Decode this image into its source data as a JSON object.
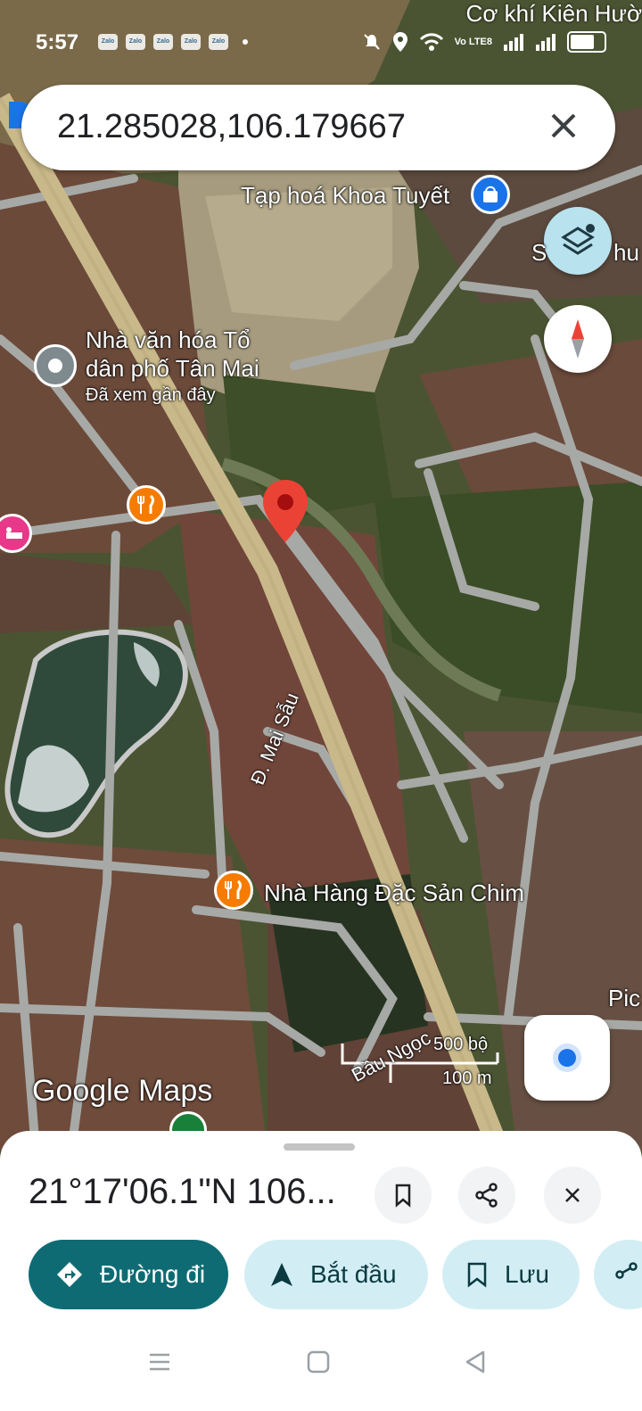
{
  "status_bar": {
    "time": "5:57",
    "notification_apps": [
      "Zalo",
      "Zalo",
      "Zalo",
      "Zalo",
      "Zalo"
    ],
    "network_label": "Vo LTE8"
  },
  "search": {
    "query": "21.285028,106.179667"
  },
  "map_labels": {
    "top_right": "Cơ khí Kiên Hườ",
    "shop": "Tạp hoá Khoa Tuyết",
    "cultural_house_line1": "Nhà văn hóa Tổ",
    "cultural_house_line2": "dân phố Tân Mai",
    "recently_viewed": "Đã xem gần đây",
    "street_mai_sau": "Đ. Mai Sẫu",
    "restaurant": "Nhà Hàng Đặc Sản Chim",
    "bau_ngoc": "Bầu Ngọc",
    "partial_right_1": "S",
    "partial_right_2": "hu",
    "partial_right_3": "Pic",
    "scale_feet": "500 bộ",
    "scale_meters": "100 m",
    "google_maps_logo": "Google Maps"
  },
  "bottom_sheet": {
    "coordinates": "21°17'06.1\"N 106...",
    "directions_label": "Đường đi",
    "start_label": "Bắt đầu",
    "save_label": "Lưu"
  },
  "colors": {
    "accent_teal": "#0f6b73",
    "pill_light": "#d2eef4",
    "pin_red": "#ea4335",
    "restaurant_orange": "#f57c00",
    "shop_blue": "#1a73e8",
    "hotel_pink": "#e8388a",
    "location_blue": "#1a73e8"
  },
  "icons": [
    "layers-icon",
    "compass-icon",
    "close-icon",
    "bookmark-icon",
    "share-icon",
    "directions-icon",
    "navigation-arrow-icon",
    "my-location-icon"
  ]
}
